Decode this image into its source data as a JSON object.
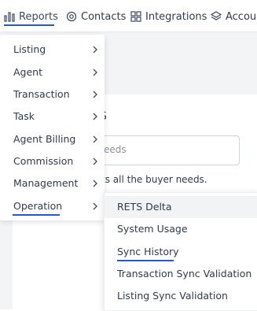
{
  "nav": {
    "items": [
      {
        "label": "Reports",
        "icon": "bar-chart-icon"
      },
      {
        "label": "Contacts",
        "icon": "at-sign-icon"
      },
      {
        "label": "Integrations",
        "icon": "grid-icon"
      },
      {
        "label": "Accour",
        "icon": "layers-icon"
      }
    ],
    "accent": "#2458d6"
  },
  "background": {
    "title_fragment": "S",
    "input_placeholder": "eeds",
    "description_fragment": "ts all the buyer needs."
  },
  "menu": {
    "items": [
      {
        "label": "Listing"
      },
      {
        "label": "Agent"
      },
      {
        "label": "Transaction"
      },
      {
        "label": "Task"
      },
      {
        "label": "Agent Billing"
      },
      {
        "label": "Commission"
      },
      {
        "label": "Management"
      },
      {
        "label": "Operation"
      }
    ]
  },
  "submenu": {
    "items": [
      {
        "label": "RETS Delta"
      },
      {
        "label": "System Usage"
      },
      {
        "label": "Sync History"
      },
      {
        "label": "Transaction Sync Validation"
      },
      {
        "label": "Listing Sync Validation"
      }
    ]
  }
}
